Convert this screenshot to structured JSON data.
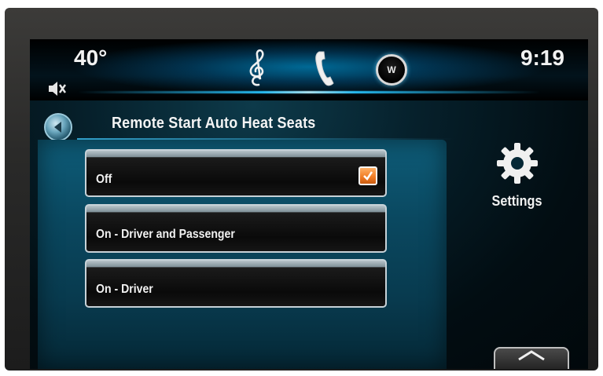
{
  "status": {
    "temperature": "40°",
    "time": "9:19",
    "nav_badge": "W"
  },
  "top_icons": [
    "music-icon",
    "phone-icon",
    "navigation-icon"
  ],
  "header": {
    "title": "Remote Start Auto Heat Seats"
  },
  "options": [
    {
      "label": "Off",
      "selected": true
    },
    {
      "label": "On - Driver and Passenger",
      "selected": false
    },
    {
      "label": "On - Driver",
      "selected": false
    }
  ],
  "settings": {
    "label": "Settings"
  },
  "colors": {
    "accent": "#29c6ff",
    "check": "#f07a22",
    "panel": "#0a4860"
  }
}
